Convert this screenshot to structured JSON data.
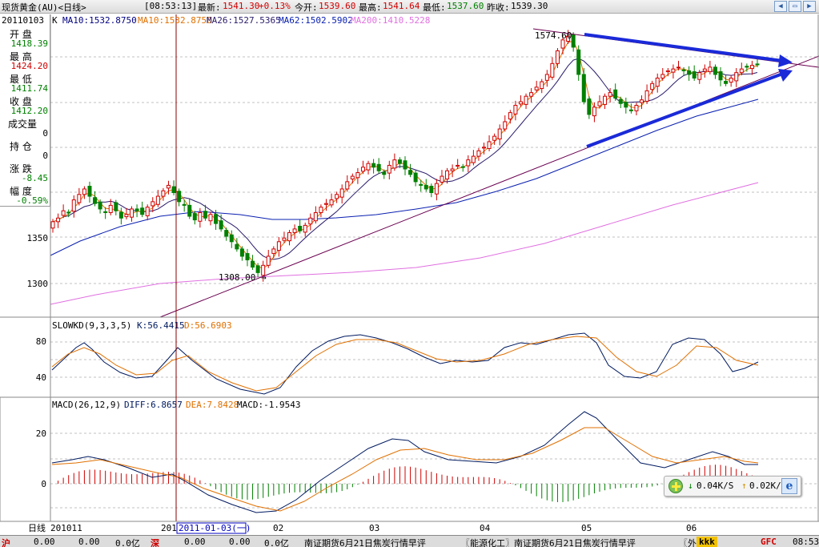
{
  "titlebar": {
    "instrument": "现货黄金(AU)<日线>",
    "time": "[08:53:13]",
    "last_label": "最新:",
    "last_value": "1541.30",
    "change": "+0.13%",
    "open_label": "今开:",
    "open_value": "1539.60",
    "high_label": "最高:",
    "high_value": "1541.64",
    "low_label": "最低:",
    "low_value": "1537.60",
    "prev_label": "昨收:",
    "prev_value": "1539.30"
  },
  "info_panel": {
    "date": "20110103",
    "open_label": "开  盘",
    "open_value": "1418.39",
    "high_label": "最  高",
    "high_value": "1424.20",
    "low_label": "最  低",
    "low_value": "1411.74",
    "close_label": "收  盘",
    "close_value": "1412.20",
    "volume_label": "成交量",
    "volume_value": "0",
    "position_label": "持  仓",
    "position_value": "0",
    "change_label": "涨  跌",
    "change_value": "-8.45",
    "range_label": "幅  度",
    "range_value": "-0.59%"
  },
  "colors": {
    "up": "#d00000",
    "down": "#008000",
    "ma10": "#000080",
    "ma10b": "#e07000",
    "ma26": "#2a1a6a",
    "ma62": "#0a20b0",
    "ma200": "#e070e0",
    "trend_blue": "#1a2ad8",
    "trend_purple": "#6a0050",
    "k_line": "#001a60",
    "d_line": "#e07000",
    "grid": "#c0c0c0"
  },
  "price_panel": {
    "legend": {
      "k": "K",
      "ma10": "MA10:1532.8750",
      "ma10b": "MA10:1532.8750",
      "ma26": "MA26:1527.5365",
      "ma62": "MA62:1502.5902",
      "ma200": "MA200:1410.5228"
    },
    "y_ticks": [
      "1350",
      "1300"
    ],
    "annotation_high": "1574.60",
    "annotation_low": "1308.00"
  },
  "kd_panel": {
    "legend": {
      "name": "SLOWKD(9,3,3,5)",
      "k": "K:56.4415",
      "d": "D:56.6903"
    },
    "y_ticks": [
      "80",
      "40"
    ]
  },
  "macd_panel": {
    "legend": {
      "name": "MACD(26,12,9)",
      "diff": "DIFF:6.8657",
      "dea": "DEA:7.8428",
      "macd": "MACD:-1.9543"
    },
    "y_ticks": [
      "20",
      "0"
    ]
  },
  "x_axis": {
    "period_label": "日线",
    "labels": [
      "201011",
      "201",
      "2011-01-03(一)",
      "02",
      "03",
      "04",
      "05",
      "06"
    ]
  },
  "speed_popup": {
    "down": "0.04K/S",
    "up": "0.02K/S"
  },
  "statusbar": {
    "sh_label": "沪",
    "sh_v1": "0.00",
    "sh_v2": "0.00",
    "sh_v3": "0.0亿",
    "sz_label": "深",
    "sz_v1": "0.00",
    "sz_v2": "0.00",
    "sz_v3": "0.0亿",
    "news1": "南证期货6月21日焦炭行情早评",
    "news2": "〖能源化工〗南证期货6月21日焦炭行情早评",
    "news3": "〖外",
    "kkk": "kkk",
    "gfc": "GFC",
    "clock": "08:53"
  }
}
